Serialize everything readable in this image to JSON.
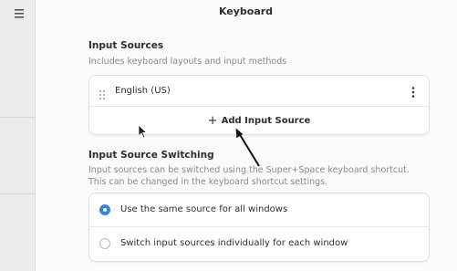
{
  "header": {
    "title": "Keyboard",
    "menu_icon": "hamburger-menu-icon"
  },
  "input_sources": {
    "title": "Input Sources",
    "description": "Includes keyboard layouts and input methods",
    "items": [
      {
        "label": "English (US)",
        "drag_icon": "drag-handle-icon",
        "menu_icon": "kebab-menu-icon"
      }
    ],
    "add_label": "Add Input Source",
    "add_icon": "plus-icon"
  },
  "switching": {
    "title": "Input Source Switching",
    "description_line1": "Input sources can be switched using the Super+Space keyboard shortcut.",
    "description_line2": "This can be changed in the keyboard shortcut settings.",
    "options": [
      {
        "label": "Use the same source for all windows",
        "selected": true
      },
      {
        "label": "Switch input sources individually for each window",
        "selected": false
      }
    ]
  },
  "colors": {
    "accent": "#3584e4",
    "background": "#fafafa",
    "card": "#ffffff",
    "sidebar": "#ececec"
  }
}
